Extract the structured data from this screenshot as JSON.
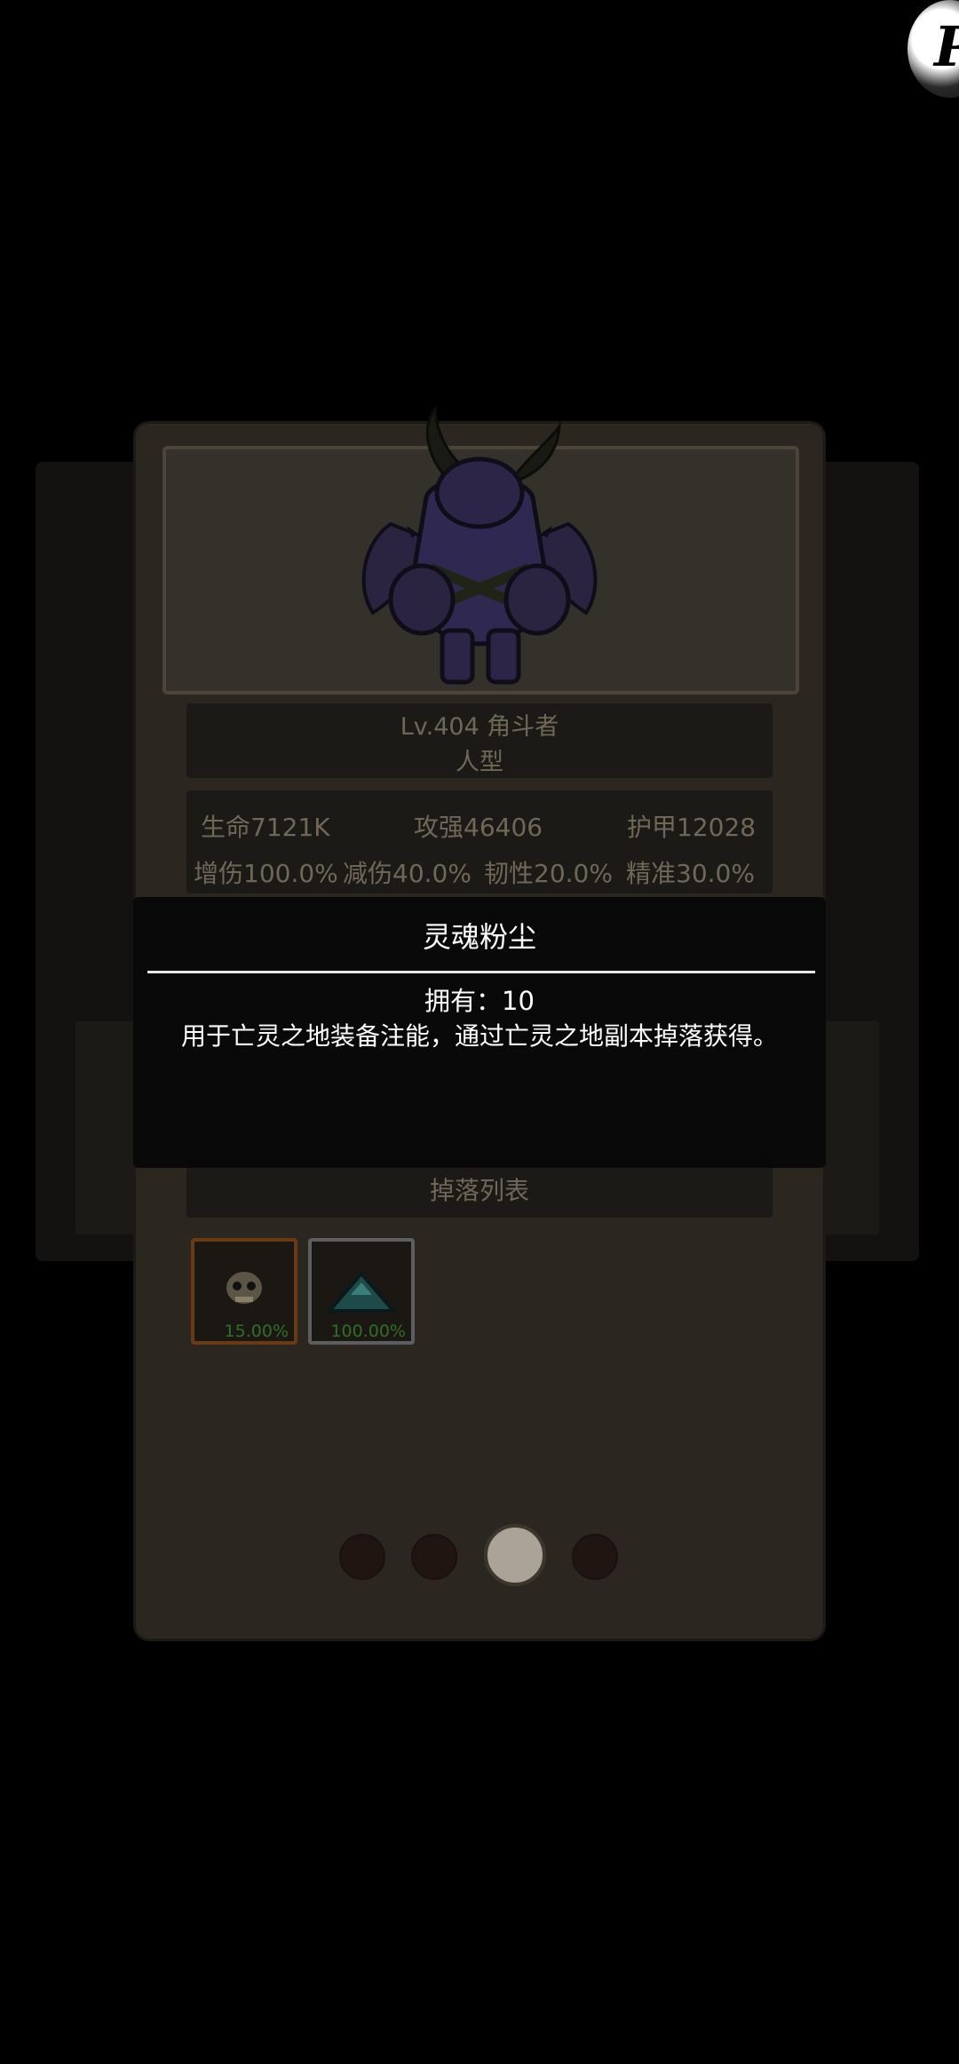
{
  "monster": {
    "level_name": "Lv.404 角斗者",
    "type": "人型"
  },
  "stats": {
    "hp": "生命7121K",
    "attack": "攻强46406",
    "armor": "护甲12028",
    "dmg_inc": "增伤100.0%",
    "dmg_red": "减伤40.0%",
    "toughness": "韧性20.0%",
    "accuracy": "精准30.0%"
  },
  "drops": {
    "label": "掉落列表",
    "items": [
      {
        "icon": "skull-helmet-icon",
        "rate": "15.00%"
      },
      {
        "icon": "soul-dust-pile-icon",
        "rate": "100.00%"
      }
    ]
  },
  "pager": {
    "count": 4,
    "active_index": 2
  },
  "tooltip": {
    "title": "灵魂粉尘",
    "own_label": "拥有：",
    "own_value": "10",
    "description": "用于亡灵之地装备注能，通过亡灵之地副本掉落获得。"
  },
  "fab": {
    "icon": "p-logo-icon",
    "glyph": "P"
  },
  "colors": {
    "card_bg": "#2b2720",
    "text_dim": "#6f6859",
    "tooltip_bg": "#080808",
    "drop_rate_green": "#2f6f25",
    "rare_border": "#6a3a12"
  }
}
